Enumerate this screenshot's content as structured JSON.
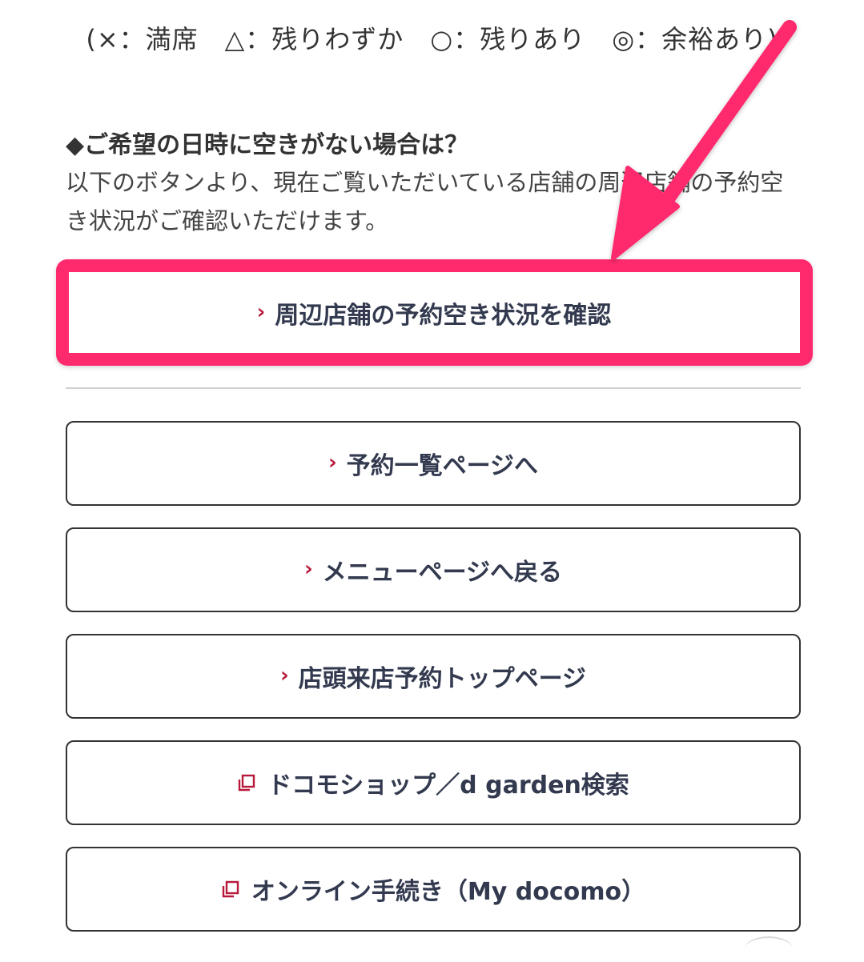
{
  "legend": {
    "text": "(×：満席　△：残りわずか　○：残りあり　◎：余裕あり)"
  },
  "notice": {
    "heading": "◆ご希望の日時に空きがない場合は？",
    "body": "以下のボタンより、現在ご覧いただいている店舗の周辺店舗の予約空き状況がご確認いただけます。"
  },
  "buttons": {
    "nearby_stores": "周辺店舗の予約空き状況を確認",
    "reservation_list": "予約一覧ページへ",
    "back_to_menu": "メニューページへ戻る",
    "store_reservation_top": "店頭来店予約トップページ",
    "docomo_shop_search": "ドコモショップ／d garden検索",
    "online_procedures": "オンライン手続き（My docomo）"
  },
  "icons": {
    "chevron": "chevron-right-icon",
    "external": "external-window-icon"
  },
  "colors": {
    "highlight": "#ff2a6d",
    "chevron": "#b8193a",
    "button_text": "#333a4f",
    "border": "#333333"
  }
}
